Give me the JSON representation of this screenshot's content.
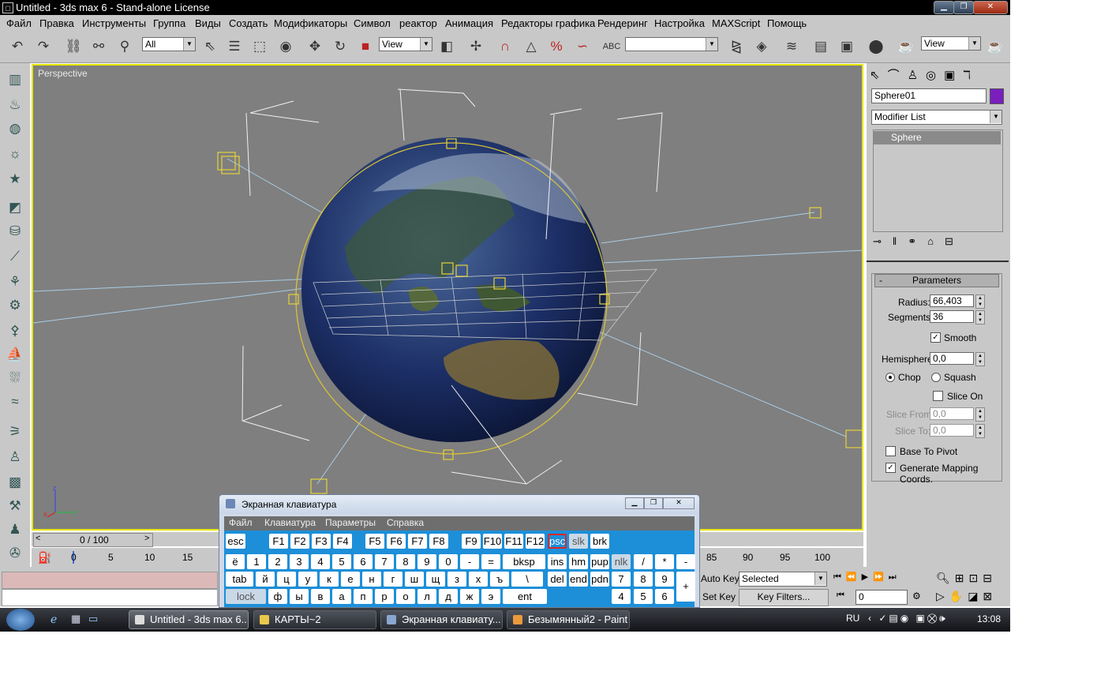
{
  "window": {
    "title": "Untitled - 3ds max 6 - Stand-alone License",
    "btn_min": "▁",
    "btn_max": "❐",
    "btn_close": "✕"
  },
  "menu": [
    "Файл",
    "Правка",
    "Инструменты",
    "Группа",
    "Виды",
    "Создать",
    "Модификаторы",
    "Символ",
    "реактор",
    "Анимация",
    "Редакторы графика",
    "Рендеринг",
    "Настройка",
    "MAXScript",
    "Помощь"
  ],
  "toolbar": {
    "selection_filter": "All",
    "ref_coord": "View",
    "named_sel": "",
    "render_type": "View",
    "spinner_snap": "%",
    "angle_snap_label": "3",
    "axis_label": "3"
  },
  "viewport": {
    "label": "Perspective",
    "axis_x": "x",
    "axis_y": "y",
    "axis_z": "z"
  },
  "time": {
    "slider": "0 / 100",
    "prev": "<",
    "next": ">",
    "ticks": [
      "0",
      "5",
      "10",
      "15",
      "85",
      "90",
      "95",
      "100"
    ]
  },
  "status": {
    "auto_key": "Auto Key",
    "set_key": "Set Key",
    "key_mode": "Selected",
    "key_filters": "Key Filters...",
    "frame": "0"
  },
  "command_panel": {
    "object_name": "Sphere01",
    "object_color": "#7a1ebe",
    "modifier_list": "Modifier List",
    "stack_item": "Sphere",
    "rollout_title": "Parameters",
    "rollout_toggle": "-",
    "radius_label": "Radius:",
    "radius": "66,403",
    "segments_label": "Segments:",
    "segments": "36",
    "smooth_label": "Smooth",
    "smooth_checked": true,
    "hemisphere_label": "Hemisphere:",
    "hemisphere": "0,0",
    "chop_label": "Chop",
    "squash_label": "Squash",
    "slice_on_label": "Slice On",
    "slice_from_label": "Slice From:",
    "slice_from": "0,0",
    "slice_to_label": "Slice To:",
    "slice_to": "0,0",
    "base_to_pivot_label": "Base To Pivot",
    "gen_mapping_label": "Generate Mapping Coords."
  },
  "osk": {
    "title": "Экранная клавиатура",
    "menu": [
      "Файл",
      "Клавиатура",
      "Параметры",
      "Справка"
    ],
    "row1": [
      "esc",
      "F1",
      "F2",
      "F3",
      "F4",
      "F5",
      "F6",
      "F7",
      "F8",
      "F9",
      "F10",
      "F11",
      "F12",
      "psc",
      "slk",
      "brk"
    ],
    "row2": [
      "ё",
      "1",
      "2",
      "3",
      "4",
      "5",
      "6",
      "7",
      "8",
      "9",
      "0",
      "-",
      "=",
      "bksp",
      "ins",
      "hm",
      "pup",
      "nlk",
      "/",
      "*",
      "-"
    ],
    "row3": [
      "tab",
      "й",
      "ц",
      "у",
      "к",
      "е",
      "н",
      "г",
      "ш",
      "щ",
      "з",
      "х",
      "ъ",
      "\\",
      "del",
      "end",
      "pdn",
      "7",
      "8",
      "9",
      "+"
    ],
    "row4": [
      "lock",
      "ф",
      "ы",
      "в",
      "а",
      "п",
      "р",
      "о",
      "л",
      "д",
      "ж",
      "э",
      "ent",
      "4",
      "5",
      "6"
    ]
  },
  "taskbar": {
    "tasks": [
      "Untitled - 3ds max 6...",
      "КАРТЫ~2",
      "Экранная клавиату...",
      "Безымянный2 - Paint"
    ],
    "lang": "RU",
    "clock": "13:08"
  },
  "colors": {
    "viewport_bg": "#7f7f7f",
    "active_border": "#e6e600",
    "ui_gray": "#c8c8c8",
    "osk_blue": "#1d8fd8"
  }
}
